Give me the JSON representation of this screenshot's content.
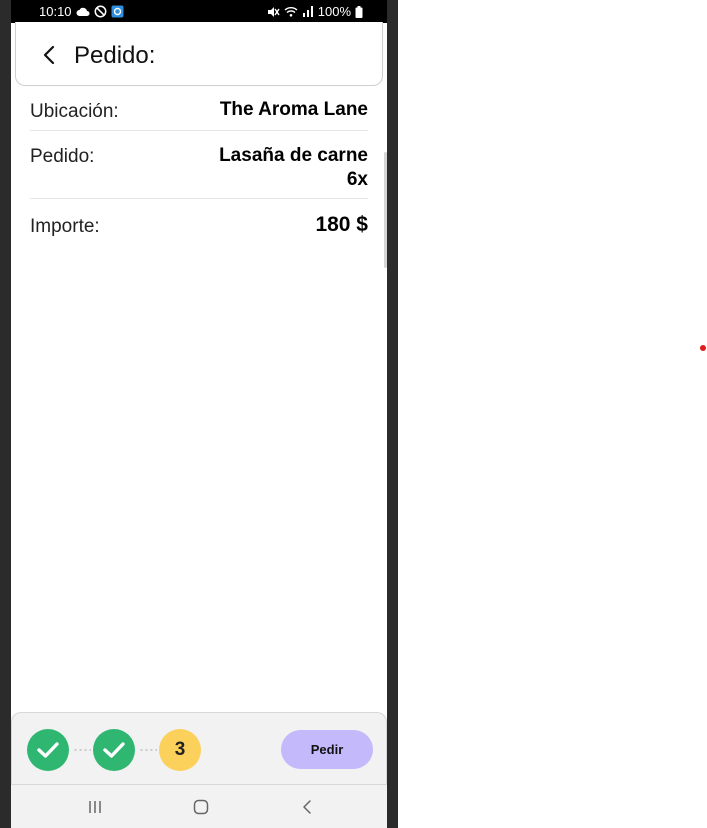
{
  "status_bar": {
    "time": "10:10",
    "battery": "100%",
    "left_icons": [
      "cloud-icon",
      "do-not-disturb-icon",
      "app-notification-icon"
    ],
    "right_icons": [
      "mute-icon",
      "wifi-icon",
      "signal-icon",
      "battery-icon"
    ]
  },
  "header": {
    "title": "Pedido:",
    "back_icon": "back-arrow-icon"
  },
  "details": [
    {
      "label": "Ubicación:",
      "value": "The Aroma Lane"
    },
    {
      "label": "Pedido:",
      "value_line1": "Lasaña de carne",
      "value_line2": "6x"
    },
    {
      "label": "Importe:",
      "value": "180 $"
    }
  ],
  "stepper": {
    "steps": [
      {
        "state": "done",
        "icon": "check-icon"
      },
      {
        "state": "done",
        "icon": "check-icon"
      },
      {
        "state": "current",
        "label": "3"
      }
    ],
    "action_label": "Pedir"
  },
  "system_nav": {
    "icons": [
      "recent-apps-icon",
      "home-icon",
      "back-nav-icon"
    ]
  },
  "colors": {
    "step_done": "#2fb772",
    "step_current": "#fbd15b",
    "action_button": "#c3b9fb",
    "status_bar": "#000000",
    "device_frame": "#2b2b2b",
    "indicator_dot": "#e01b1b"
  }
}
